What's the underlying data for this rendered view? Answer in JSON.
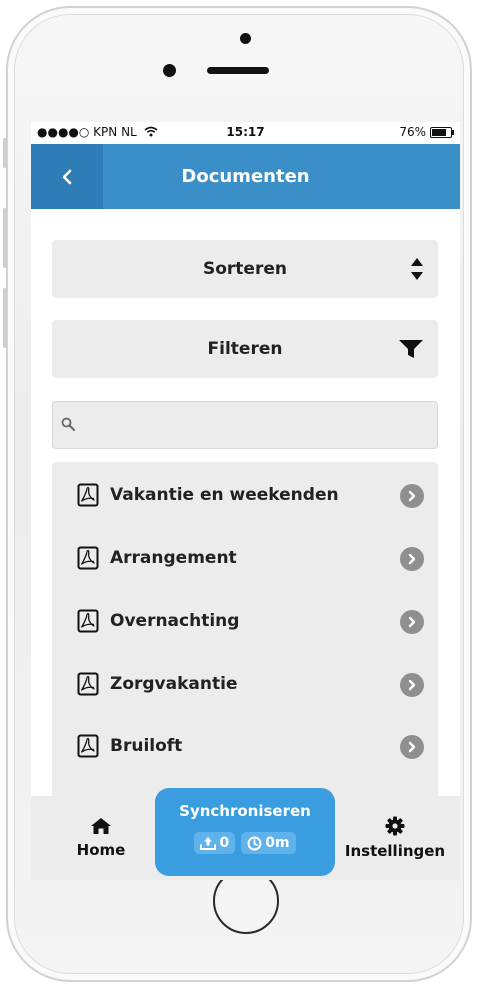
{
  "status_bar": {
    "carrier": "●●●●○ KPN NL",
    "wifi_icon": "wifi-icon",
    "time": "15:17",
    "battery": "76%"
  },
  "navbar": {
    "back_icon": "chevron-left-icon",
    "title": "Documenten"
  },
  "controls": {
    "sort_label": "Sorteren",
    "sort_icon": "sort-icon",
    "filter_label": "Filteren",
    "filter_icon": "funnel-icon",
    "search_placeholder": "",
    "search_icon": "search-icon"
  },
  "documents": [
    {
      "label": "Vakantie en weekenden"
    },
    {
      "label": "Arrangement"
    },
    {
      "label": "Overnachting"
    },
    {
      "label": "Zorgvakantie"
    },
    {
      "label": "Bruiloft"
    }
  ],
  "tabbar": {
    "home_label": "Home",
    "settings_label": "Instellingen",
    "sync_label": "Synchroniseren",
    "sync_upload_count": "0",
    "sync_time": "0m"
  },
  "colors": {
    "navbar": "#3a8fc9",
    "back_button": "#2e7db6",
    "sync_button": "#3a9de0",
    "surface": "#ececec"
  }
}
